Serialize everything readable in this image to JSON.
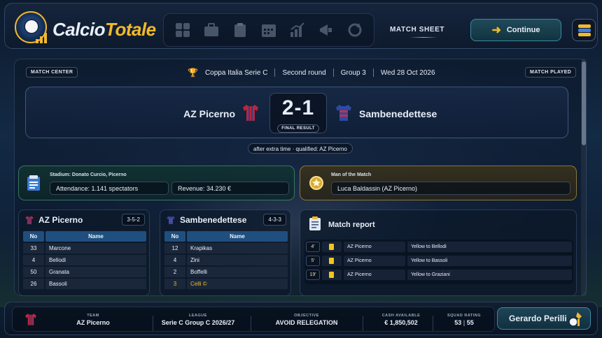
{
  "app": {
    "brand_part1": "Calcio",
    "brand_part2": "Totale"
  },
  "nav_icons": [
    "dashboard-icon",
    "briefcase-icon",
    "clipboard-icon",
    "calendar-icon",
    "stats-icon",
    "megaphone-icon",
    "refresh-icon"
  ],
  "header": {
    "title": "MATCH SHEET",
    "continue_label": "Continue"
  },
  "match": {
    "center_label": "MATCH CENTER",
    "status_label": "MATCH PLAYED",
    "competition": "Coppa Italia Serie C",
    "round": "Second round",
    "group": "Group 3",
    "date": "Wed 28 Oct 2026",
    "home_team": "AZ Picerno",
    "away_team": "Sambenedettese",
    "score": "2-1",
    "result_label": "FINAL RESULT",
    "note": "after extra time · qualified: AZ Picerno"
  },
  "stadium": {
    "label": "Stadium: Donato Curcio, Picerno",
    "attendance": "Attendance: 1.141 spectators",
    "revenue": "Revenue: 34.230 €"
  },
  "motm": {
    "label": "Man of the Match",
    "player": "Luca Baldassin (AZ Picerno)"
  },
  "lineups": {
    "columns": [
      "No",
      "Name"
    ],
    "home": {
      "team": "AZ Picerno",
      "formation": "3-5-2",
      "players": [
        {
          "no": "33",
          "name": "Marcone"
        },
        {
          "no": "4",
          "name": "Bellodi"
        },
        {
          "no": "50",
          "name": "Granata"
        },
        {
          "no": "26",
          "name": "Bassoli"
        }
      ]
    },
    "away": {
      "team": "Sambenedettese",
      "formation": "4-3-3",
      "players": [
        {
          "no": "12",
          "name": "Krapikas"
        },
        {
          "no": "4",
          "name": "Zini"
        },
        {
          "no": "2",
          "name": "Boffelli"
        },
        {
          "no": "3",
          "name": "Celli ©"
        }
      ]
    }
  },
  "report": {
    "title": "Match report",
    "events": [
      {
        "minute": "4'",
        "type": "yellow-card",
        "team": "AZ Picerno",
        "text": "Yellow to Bellodi"
      },
      {
        "minute": "5'",
        "type": "yellow-card",
        "team": "AZ Picerno",
        "text": "Yellow to Bassoli"
      },
      {
        "minute": "19'",
        "type": "yellow-card",
        "team": "AZ Picerno",
        "text": "Yellow to Graziani"
      }
    ]
  },
  "footer": {
    "team_label": "TEAM",
    "team": "AZ Picerno",
    "league_label": "LEAGUE",
    "league": "Serie C Group C 2026/27",
    "objective_label": "OBJECTIVE",
    "objective": "AVOID RELEGATION",
    "cash_label": "CASH AVAILABLE",
    "cash": "€ 1,850,502",
    "rating_label": "SQUAD RATING",
    "rating_a": "53",
    "rating_b": "55",
    "manager": "Gerardo Perilli"
  },
  "colors": {
    "accent": "#f1b92c",
    "yellow_card": "#f5c518",
    "header_blue": "#1f4f7e"
  }
}
